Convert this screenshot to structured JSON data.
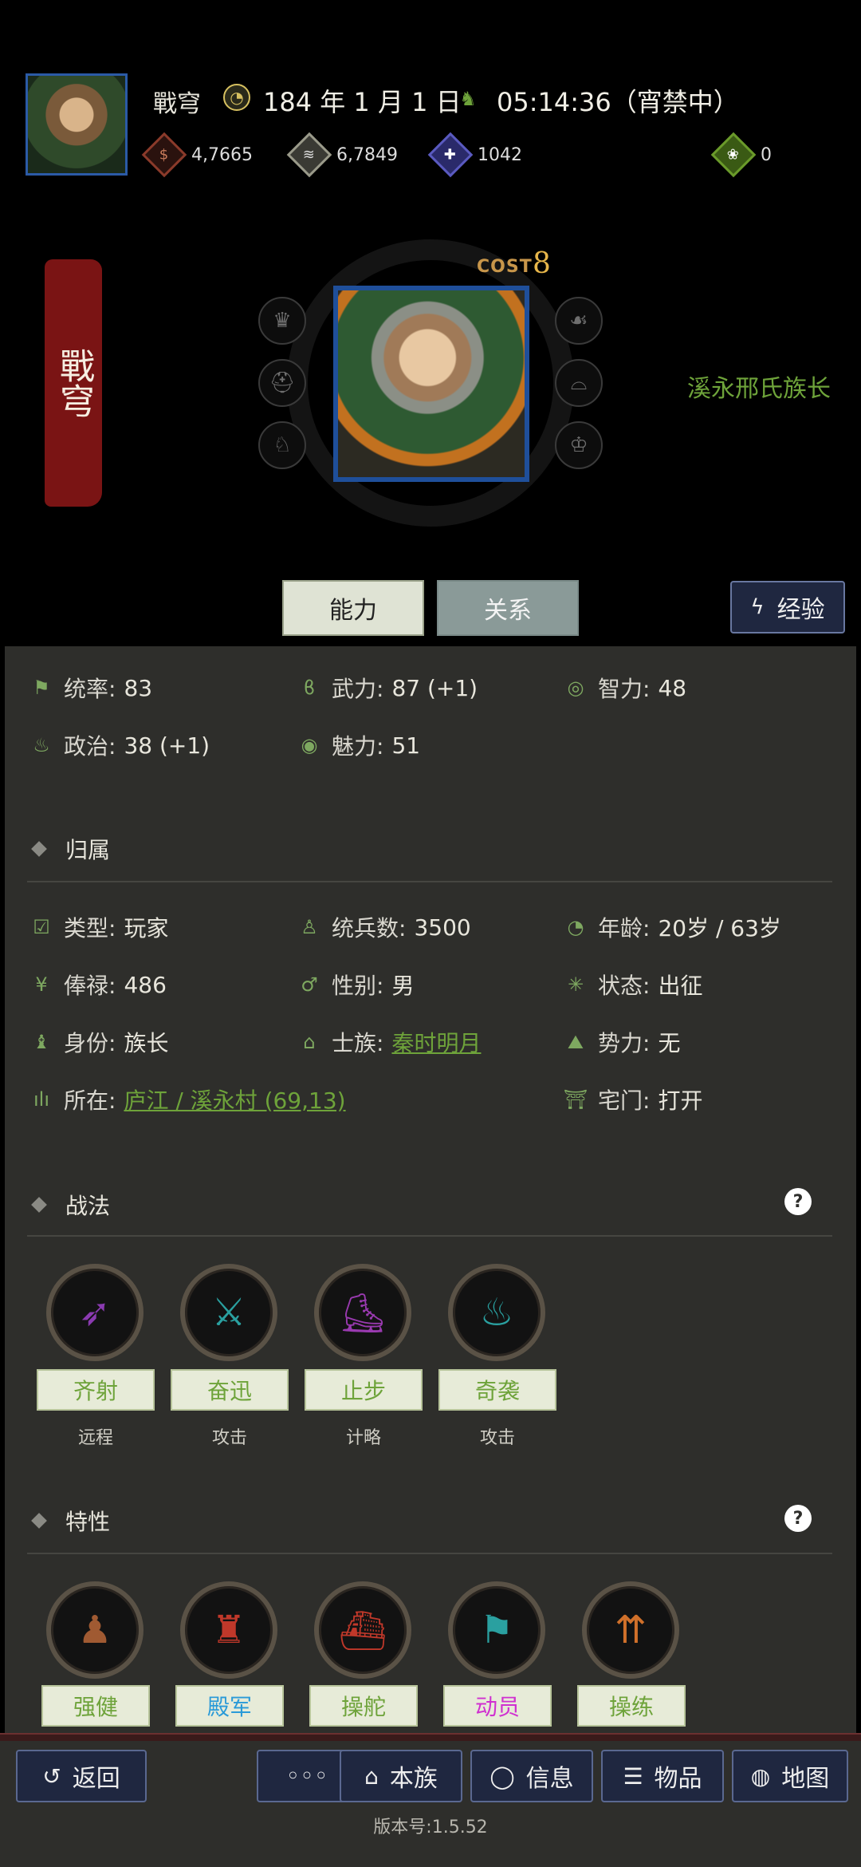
{
  "header": {
    "name": "戰穹",
    "date": "184 年 1 月 1 日",
    "time": "05:14:36（宵禁中）",
    "resources": [
      {
        "icon": "coin-bag-icon",
        "value": "4,7665",
        "color": "#8a3a2a"
      },
      {
        "icon": "grain-icon",
        "value": "6,7849",
        "color": "#8a8a7a"
      },
      {
        "icon": "soldier-icon",
        "value": "1042",
        "color": "#4a4aa0"
      },
      {
        "icon": "money-pouch-icon",
        "value": "0",
        "color": "#5a8a2a"
      }
    ]
  },
  "character": {
    "banner_name": "戰穹",
    "cost_label": "COST",
    "cost_value": "8",
    "title": "溪永邢氏族长",
    "left_slots": [
      "crown-icon",
      "helmet-icon",
      "horse-icon"
    ],
    "right_slots": [
      "hand-gift-icon",
      "hat-icon",
      "scholar-cap-icon"
    ]
  },
  "tabs": {
    "ability": "能力",
    "relations": "关系",
    "experience": "经验"
  },
  "stats": [
    {
      "icon": "flag-icon",
      "label": "统率:",
      "value": "83"
    },
    {
      "icon": "arm-icon",
      "label": "武力:",
      "value": "87 (+1)"
    },
    {
      "icon": "brain-icon",
      "label": "智力:",
      "value": "48"
    },
    {
      "icon": "pot-icon",
      "label": "政治:",
      "value": "38 (+1)"
    },
    {
      "icon": "eye-icon",
      "label": "魅力:",
      "value": "51"
    }
  ],
  "affiliation": {
    "header": "归属",
    "items": [
      {
        "icon": "checkbox-icon",
        "label": "类型:",
        "value": "玩家"
      },
      {
        "icon": "person-icon",
        "label": "统兵数:",
        "value": "3500"
      },
      {
        "icon": "age-icon",
        "label": "年龄:",
        "value": "20岁 / 63岁"
      },
      {
        "icon": "yen-icon",
        "label": "俸禄:",
        "value": "486"
      },
      {
        "icon": "gender-icon",
        "label": "性别:",
        "value": "男"
      },
      {
        "icon": "status-icon",
        "label": "状态:",
        "value": "出征"
      },
      {
        "icon": "identity-icon",
        "label": "身份:",
        "value": "族长"
      },
      {
        "icon": "clan-icon",
        "label": "士族:",
        "value": "秦时明月"
      },
      {
        "icon": "faction-icon",
        "label": "势力:",
        "value": "无"
      },
      {
        "icon": "location-icon",
        "label": "所在:",
        "value": "庐江 / 溪永村 (69,13)"
      },
      {
        "icon": "gate-icon",
        "label": "宅门:",
        "value": "打开"
      }
    ]
  },
  "tactics": {
    "header": "战法",
    "help": "?",
    "items": [
      {
        "name": "齐射",
        "type": "远程",
        "icon": "volley-icon",
        "color": "#8a3ab0",
        "name_color": "#6ea33a"
      },
      {
        "name": "奋迅",
        "type": "攻击",
        "icon": "crossed-swords-icon",
        "color": "#2aa0a0",
        "name_color": "#6ea33a"
      },
      {
        "name": "止步",
        "type": "计略",
        "icon": "boot-icon",
        "color": "#9a3ab0",
        "name_color": "#6ea33a"
      },
      {
        "name": "奇袭",
        "type": "攻击",
        "icon": "flame-icon",
        "color": "#2aa0a0",
        "name_color": "#6ea33a"
      }
    ]
  },
  "traits": {
    "header": "特性",
    "help": "?",
    "items": [
      {
        "name": "强健",
        "icon": "strongman-icon",
        "color": "#8a4a2a",
        "name_color": "#6ea33a"
      },
      {
        "name": "殿军",
        "icon": "armor-icon",
        "color": "#c0382a",
        "name_color": "#2a9ad8"
      },
      {
        "name": "操舵",
        "icon": "ship-icon",
        "color": "#c0382a",
        "name_color": "#6ea33a"
      },
      {
        "name": "动员",
        "icon": "banner-flag-icon",
        "color": "#2aa0a0",
        "name_color": "#d030d0"
      },
      {
        "name": "操练",
        "icon": "spears-icon",
        "color": "#d0702a",
        "name_color": "#6ea33a"
      }
    ]
  },
  "nav": {
    "back": "返回",
    "more": "◦◦◦",
    "clan": "本族",
    "info": "信息",
    "items": "物品",
    "map": "地图"
  },
  "version": "版本号:1.5.52"
}
